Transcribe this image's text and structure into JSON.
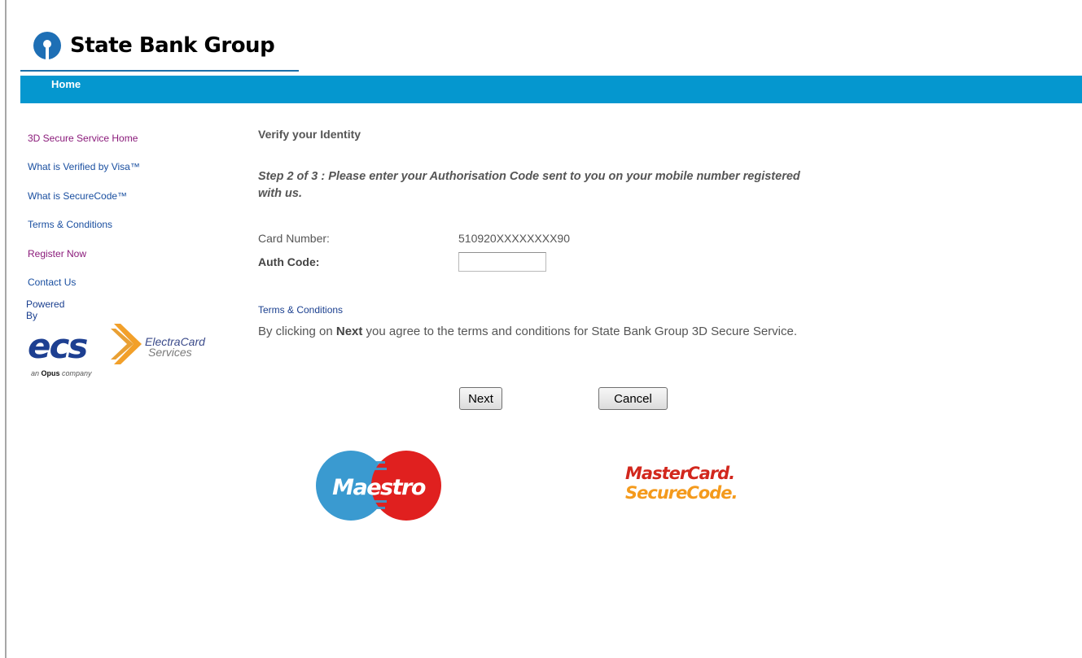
{
  "header": {
    "brand": "State Bank Group",
    "nav": {
      "home": "Home"
    }
  },
  "sidebar": {
    "items": [
      {
        "label": "3D Secure Service  Home"
      },
      {
        "label": "What is Verified by Visa™"
      },
      {
        "label": "What is SecureCode™"
      },
      {
        "label": "Terms & Conditions"
      },
      {
        "label": "Register Now"
      },
      {
        "label": "Contact Us"
      }
    ],
    "powered_by": "Powered By",
    "partner": {
      "name": "ecs",
      "line1": "ElectraCard",
      "line2": "Services",
      "tag_prefix": "an ",
      "tag_bold": "Opus",
      "tag_suffix": " company"
    }
  },
  "main": {
    "heading": "Verify your Identity",
    "step": "Step 2 of 3 : Please enter your Authorisation Code sent to you on your mobile number registered with us.",
    "card_label": "Card Number:",
    "card_value": "510920XXXXXXXX90",
    "auth_label": "Auth Code:",
    "auth_value": "",
    "terms_link": "Terms & Conditions",
    "agree_prefix": "By clicking on ",
    "agree_bold": "Next",
    "agree_suffix": " you agree to the terms and conditions for State Bank Group 3D Secure Service.",
    "next_label": "Next",
    "cancel_label": "Cancel"
  },
  "logos": {
    "maestro": "Maestro",
    "mc_line1": "MasterCard.",
    "mc_line2": "SecureCode."
  },
  "colors": {
    "nav_bar": "#0597cf",
    "link_purple": "#8a1a7a",
    "link_blue": "#1a4fa0",
    "maestro_blue": "#3a9ad0",
    "maestro_red": "#e0201f",
    "mc_red": "#d2271d",
    "mc_orange": "#f49a1c"
  }
}
